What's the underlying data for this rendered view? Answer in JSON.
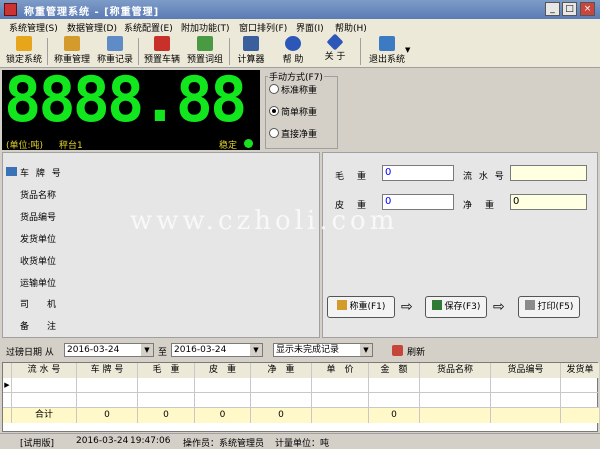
{
  "window": {
    "title": "称重管理系统 - [称重管理]",
    "minimize": "_",
    "maximize": "□",
    "close": "×"
  },
  "menu": [
    "系统管理(S)",
    "数据管理(D)",
    "系统配置(E)",
    "附加功能(T)",
    "窗口排列(F)",
    "界面(I)",
    "帮助(H)"
  ],
  "toolbar": {
    "lock": "锁定系统",
    "weigh": "称重管理",
    "records": "称重记录",
    "preset_vehicle": "预置车辆",
    "preset_words": "预置词组",
    "calculator": "计算器",
    "help": "帮 助",
    "about": "关 于",
    "exit": "退出系统"
  },
  "display": {
    "reading": "8888.88",
    "unit": "(单位:吨)",
    "scale": "秤台1",
    "status": "稳定"
  },
  "mode": {
    "legend": "手动方式(F7)",
    "options": [
      "标准称重",
      "简单称重",
      "直接净重"
    ],
    "selected": 1
  },
  "form_labels": [
    "车 牌 号",
    "货品名称",
    "货品编号",
    "发货单位",
    "收货单位",
    "运输单位",
    "司　　机",
    "备　　注"
  ],
  "weights": {
    "gross_label": "毛　重",
    "gross_value": "0",
    "tare_label": "皮　重",
    "tare_value": "0",
    "serial_label": "流 水 号",
    "serial_value": "",
    "net_label": "净　重",
    "net_value": "0"
  },
  "actions": {
    "weigh": "称重(F1)",
    "save": "保存(F3)",
    "print": "打印(F5)"
  },
  "filter": {
    "label": "过磅日期 从",
    "from": "2016-03-24",
    "to_label": "至",
    "to": "2016-03-24",
    "view": "显示未完成记录",
    "refresh": "刷新"
  },
  "grid": {
    "columns": [
      "流 水 号",
      "车 牌 号",
      "毛　重",
      "皮　重",
      "净　重",
      "单　价",
      "金　额",
      "货品名称",
      "货品编号",
      "发货单"
    ],
    "rows": [
      [
        "",
        "",
        "",
        "",
        "",
        "",
        "",
        "",
        "",
        ""
      ],
      [
        "",
        "",
        "",
        "",
        "",
        "",
        "",
        "",
        "",
        ""
      ]
    ],
    "total": [
      "合计",
      "0",
      "0",
      "0",
      "0",
      "",
      "0",
      "",
      "",
      ""
    ]
  },
  "status": {
    "edition": "[试用版]",
    "date": "2016-03-24",
    "time": "19:47:06",
    "operator": "操作员：系统管理员",
    "unit": "计量单位：吨"
  },
  "watermark": "www.czholi.com",
  "colors": {
    "digits": "#12e61c",
    "led": "#19e020",
    "display_bg": "#000000",
    "yellow_label": "#e3d628"
  }
}
